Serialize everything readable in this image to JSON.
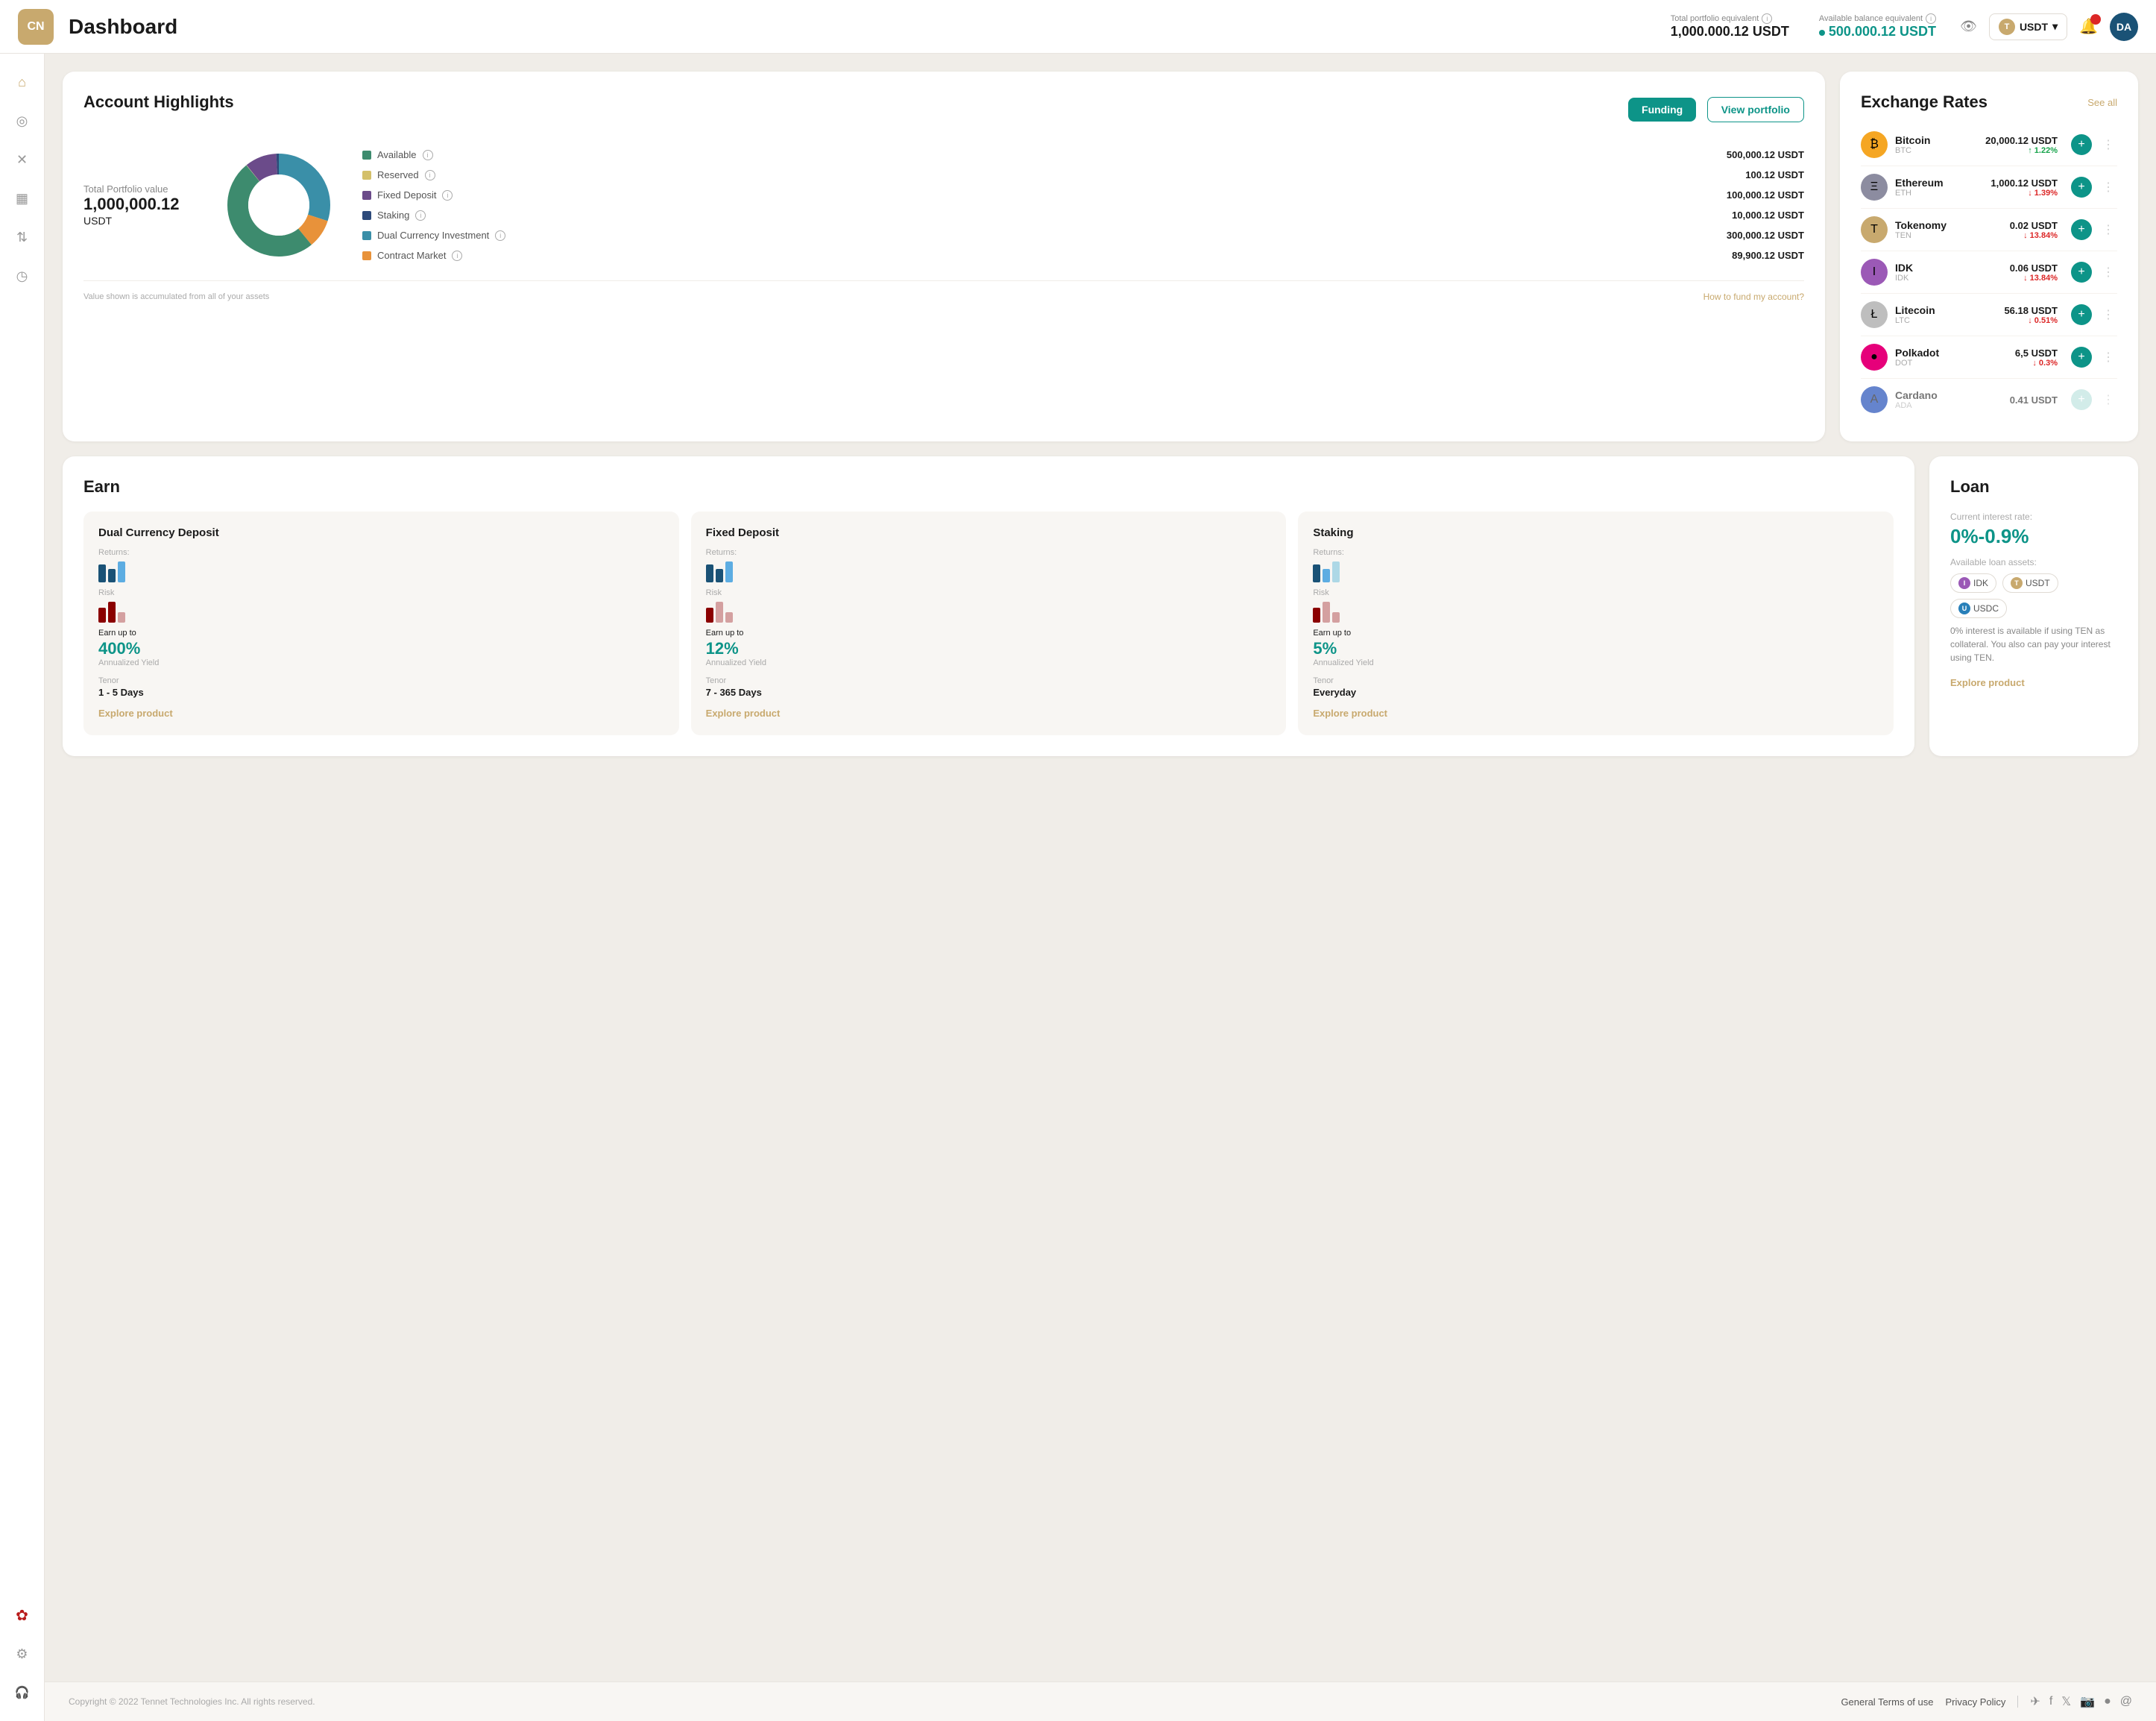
{
  "header": {
    "logo": "CN",
    "title": "Dashboard",
    "portfolio_label": "Total portfolio equivalent",
    "portfolio_value": "1,000.000.12 USDT",
    "available_label": "Available balance equivalent",
    "available_value": "500.000.12 USDT",
    "currency": "USDT",
    "avatar": "DA"
  },
  "sidebar": {
    "items": [
      {
        "name": "home",
        "icon": "⌂",
        "active": true
      },
      {
        "name": "wallet",
        "icon": "◎",
        "active": false
      },
      {
        "name": "tools",
        "icon": "✕",
        "active": false
      },
      {
        "name": "document",
        "icon": "▦",
        "active": false
      },
      {
        "name": "transfer",
        "icon": "⇅",
        "active": false
      },
      {
        "name": "history",
        "icon": "◷",
        "active": false
      }
    ],
    "bottom_items": [
      {
        "name": "globe",
        "icon": "✿",
        "accent": true
      },
      {
        "name": "settings",
        "icon": "⚙",
        "active": false
      },
      {
        "name": "support",
        "icon": "🎧",
        "active": false
      }
    ]
  },
  "account_highlights": {
    "title": "Account Highlights",
    "funding_label": "Funding",
    "view_portfolio_label": "View portfolio",
    "portfolio_label": "Total Portfolio value",
    "portfolio_value": "1,000,000.12",
    "portfolio_currency": "USDT",
    "legend": [
      {
        "label": "Available",
        "value": "500,000.12 USDT",
        "color": "#3d8b6e"
      },
      {
        "label": "Reserved",
        "value": "100.12 USDT",
        "color": "#d4c06a"
      },
      {
        "label": "Fixed Deposit",
        "value": "100,000.12 USDT",
        "color": "#6b4b8a"
      },
      {
        "label": "Staking",
        "value": "10,000.12 USDT",
        "color": "#2d4a7a"
      },
      {
        "label": "Dual Currency Investment",
        "value": "300,000.12 USDT",
        "color": "#3a8fa8"
      },
      {
        "label": "Contract Market",
        "value": "89,900.12 USDT",
        "color": "#e8923a"
      }
    ],
    "footer_note": "Value shown is accumulated from all of your assets",
    "footer_link": "How to fund my account?"
  },
  "exchange_rates": {
    "title": "Exchange Rates",
    "see_all": "See all",
    "coins": [
      {
        "name": "Bitcoin",
        "symbol": "BTC",
        "price": "20,000.12 USDT",
        "change": "↑ 1.22%",
        "up": true,
        "bg": "#f5a623",
        "letter": "₿"
      },
      {
        "name": "Ethereum",
        "symbol": "ETH",
        "price": "1,000.12 USDT",
        "change": "↓ 1.39%",
        "up": false,
        "bg": "#8c8ca0",
        "letter": "Ξ"
      },
      {
        "name": "Tokenomy",
        "symbol": "TEN",
        "price": "0.02 USDT",
        "change": "↓ 13.84%",
        "up": false,
        "bg": "#c8a96e",
        "letter": "T"
      },
      {
        "name": "IDK",
        "symbol": "IDK",
        "price": "0.06 USDT",
        "change": "↓ 13.84%",
        "up": false,
        "bg": "#9b59b6",
        "letter": "I"
      },
      {
        "name": "Litecoin",
        "symbol": "LTC",
        "price": "56.18 USDT",
        "change": "↓ 0.51%",
        "up": false,
        "bg": "#bebebe",
        "letter": "Ł"
      },
      {
        "name": "Polkadot",
        "symbol": "DOT",
        "price": "6,5 USDT",
        "change": "↓ 0.3%",
        "up": false,
        "bg": "#e6007a",
        "letter": "●"
      },
      {
        "name": "Cardano",
        "symbol": "ADA",
        "price": "0.41 USDT",
        "change": "—",
        "up": false,
        "bg": "#0033ad",
        "letter": "A"
      }
    ]
  },
  "earn": {
    "title": "Earn",
    "products": [
      {
        "name": "Dual Currency Deposit",
        "returns_label": "Returns:",
        "bars": [
          {
            "height": 24,
            "color": "#1a5276"
          },
          {
            "height": 18,
            "color": "#1a5276"
          },
          {
            "height": 28,
            "color": "#5dade2"
          }
        ],
        "bars2": [
          {
            "height": 20,
            "color": "#8b0000"
          },
          {
            "height": 28,
            "color": "#8b0000"
          },
          {
            "height": 14,
            "color": "#d4a0a0"
          }
        ],
        "risk_label": "Risk",
        "earn_up": "Earn up to",
        "pct": "400%",
        "yield_label": "Annualized Yield",
        "tenor_label": "Tenor",
        "tenor_value": "1 - 5 Days",
        "explore": "Explore product"
      },
      {
        "name": "Fixed Deposit",
        "returns_label": "Returns:",
        "bars": [
          {
            "height": 24,
            "color": "#1a5276"
          },
          {
            "height": 18,
            "color": "#1a5276"
          },
          {
            "height": 28,
            "color": "#5dade2"
          }
        ],
        "bars2": [
          {
            "height": 20,
            "color": "#8b0000"
          },
          {
            "height": 28,
            "color": "#d4a0a0"
          },
          {
            "height": 14,
            "color": "#d4a0a0"
          }
        ],
        "risk_label": "Risk",
        "earn_up": "Earn up to",
        "pct": "12%",
        "yield_label": "Annualized Yield",
        "tenor_label": "Tenor",
        "tenor_value": "7 - 365 Days",
        "explore": "Explore product"
      },
      {
        "name": "Staking",
        "returns_label": "Returns:",
        "bars": [
          {
            "height": 24,
            "color": "#1a5276"
          },
          {
            "height": 18,
            "color": "#5dade2"
          },
          {
            "height": 28,
            "color": "#add8e6"
          }
        ],
        "bars2": [
          {
            "height": 20,
            "color": "#8b0000"
          },
          {
            "height": 28,
            "color": "#d4a0a0"
          },
          {
            "height": 14,
            "color": "#d4a0a0"
          }
        ],
        "risk_label": "Risk",
        "earn_up": "Earn up to",
        "pct": "5%",
        "yield_label": "Annualized Yield",
        "tenor_label": "Tenor",
        "tenor_value": "Everyday",
        "explore": "Explore product"
      }
    ]
  },
  "loan": {
    "title": "Loan",
    "rate_label": "Current interest rate:",
    "rate": "0%-0.9%",
    "assets_label": "Available loan assets:",
    "assets": [
      {
        "symbol": "IDK",
        "bg": "#9b59b6"
      },
      {
        "symbol": "USDT",
        "bg": "#c8a96e"
      },
      {
        "symbol": "USDC",
        "bg": "#2980b9"
      }
    ],
    "note": "0% interest is available if using TEN as collateral. You also can pay your interest using TEN.",
    "explore": "Explore product"
  },
  "footer": {
    "copyright": "Copyright © 2022 Tennet Technologies Inc. All rights reserved.",
    "links": [
      {
        "label": "General Terms of use"
      },
      {
        "label": "Privacy Policy"
      }
    ],
    "socials": [
      "✈",
      "f",
      "𝕏",
      "📷",
      "●",
      "@"
    ]
  }
}
